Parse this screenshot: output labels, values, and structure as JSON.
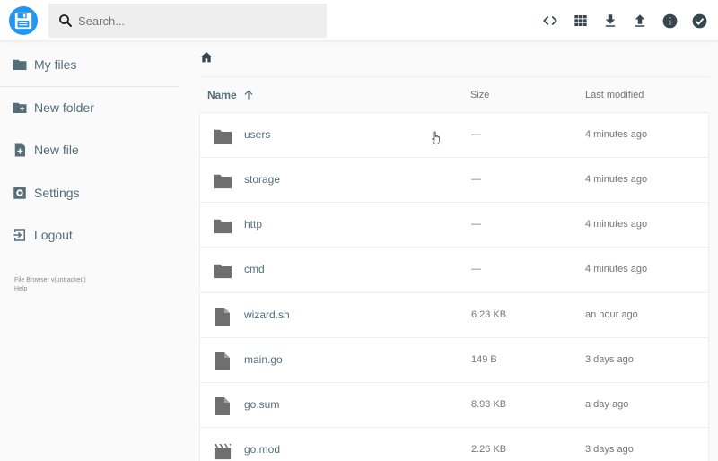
{
  "header": {
    "logo": "floppy-disk-logo",
    "search_placeholder": "Search...",
    "actions": [
      "code-icon",
      "grid-view-icon",
      "download-icon",
      "upload-icon",
      "info-icon",
      "check-circle-icon"
    ]
  },
  "sidebar": {
    "items": [
      {
        "label": "My files",
        "icon": "folder-icon"
      },
      {
        "label": "New folder",
        "icon": "create-new-folder-icon"
      },
      {
        "label": "New file",
        "icon": "note-add-icon"
      },
      {
        "label": "Settings",
        "icon": "settings-icon"
      },
      {
        "label": "Logout",
        "icon": "exit-icon"
      }
    ],
    "credits": {
      "version": "File Browser v(untracked)",
      "help": "Help"
    }
  },
  "breadcrumb": {
    "home": "home-icon"
  },
  "table": {
    "columns": {
      "name": "Name",
      "size": "Size",
      "modified": "Last modified"
    },
    "sort": "name-ascending",
    "rows": [
      {
        "name": "users",
        "size": "—",
        "modified": "4 minutes ago",
        "type": "folder"
      },
      {
        "name": "storage",
        "size": "—",
        "modified": "4 minutes ago",
        "type": "folder"
      },
      {
        "name": "http",
        "size": "—",
        "modified": "4 minutes ago",
        "type": "folder"
      },
      {
        "name": "cmd",
        "size": "—",
        "modified": "4 minutes ago",
        "type": "folder"
      },
      {
        "name": "wizard.sh",
        "size": "6.23 KB",
        "modified": "an hour ago",
        "type": "file"
      },
      {
        "name": "main.go",
        "size": "149 B",
        "modified": "3 days ago",
        "type": "file"
      },
      {
        "name": "go.sum",
        "size": "8.93 KB",
        "modified": "a day ago",
        "type": "file"
      },
      {
        "name": "go.mod",
        "size": "2.26 KB",
        "modified": "3 days ago",
        "type": "movie"
      }
    ]
  },
  "colors": {
    "accent": "#2196f3",
    "icon": "#546e7a",
    "folder": "#6f6f6f"
  }
}
